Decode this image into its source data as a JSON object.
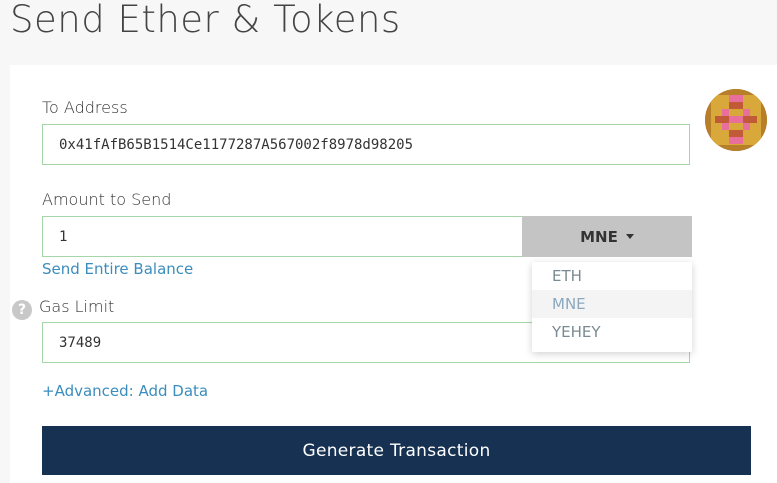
{
  "page": {
    "title": "Send Ether & Tokens"
  },
  "to_address": {
    "label": "To Address",
    "value": "0x41fAfB65B1514Ce1177287A567002f8978d98205"
  },
  "amount": {
    "label": "Amount to Send",
    "value": "1",
    "unit_selected": "MNE",
    "send_entire_balance": "Send Entire Balance",
    "unit_options": [
      "ETH",
      "MNE",
      "YEHEY"
    ]
  },
  "gas": {
    "label": "Gas Limit",
    "value": "37489",
    "help_icon": "question-mark-icon"
  },
  "advanced": {
    "label": "+Advanced: Add Data"
  },
  "generate": {
    "label": "Generate Transaction"
  },
  "colors": {
    "accent": "#3b8dbd",
    "button_bg": "#163151",
    "field_border": "#a5d6a7",
    "unit_bg": "#c4c4c4"
  }
}
